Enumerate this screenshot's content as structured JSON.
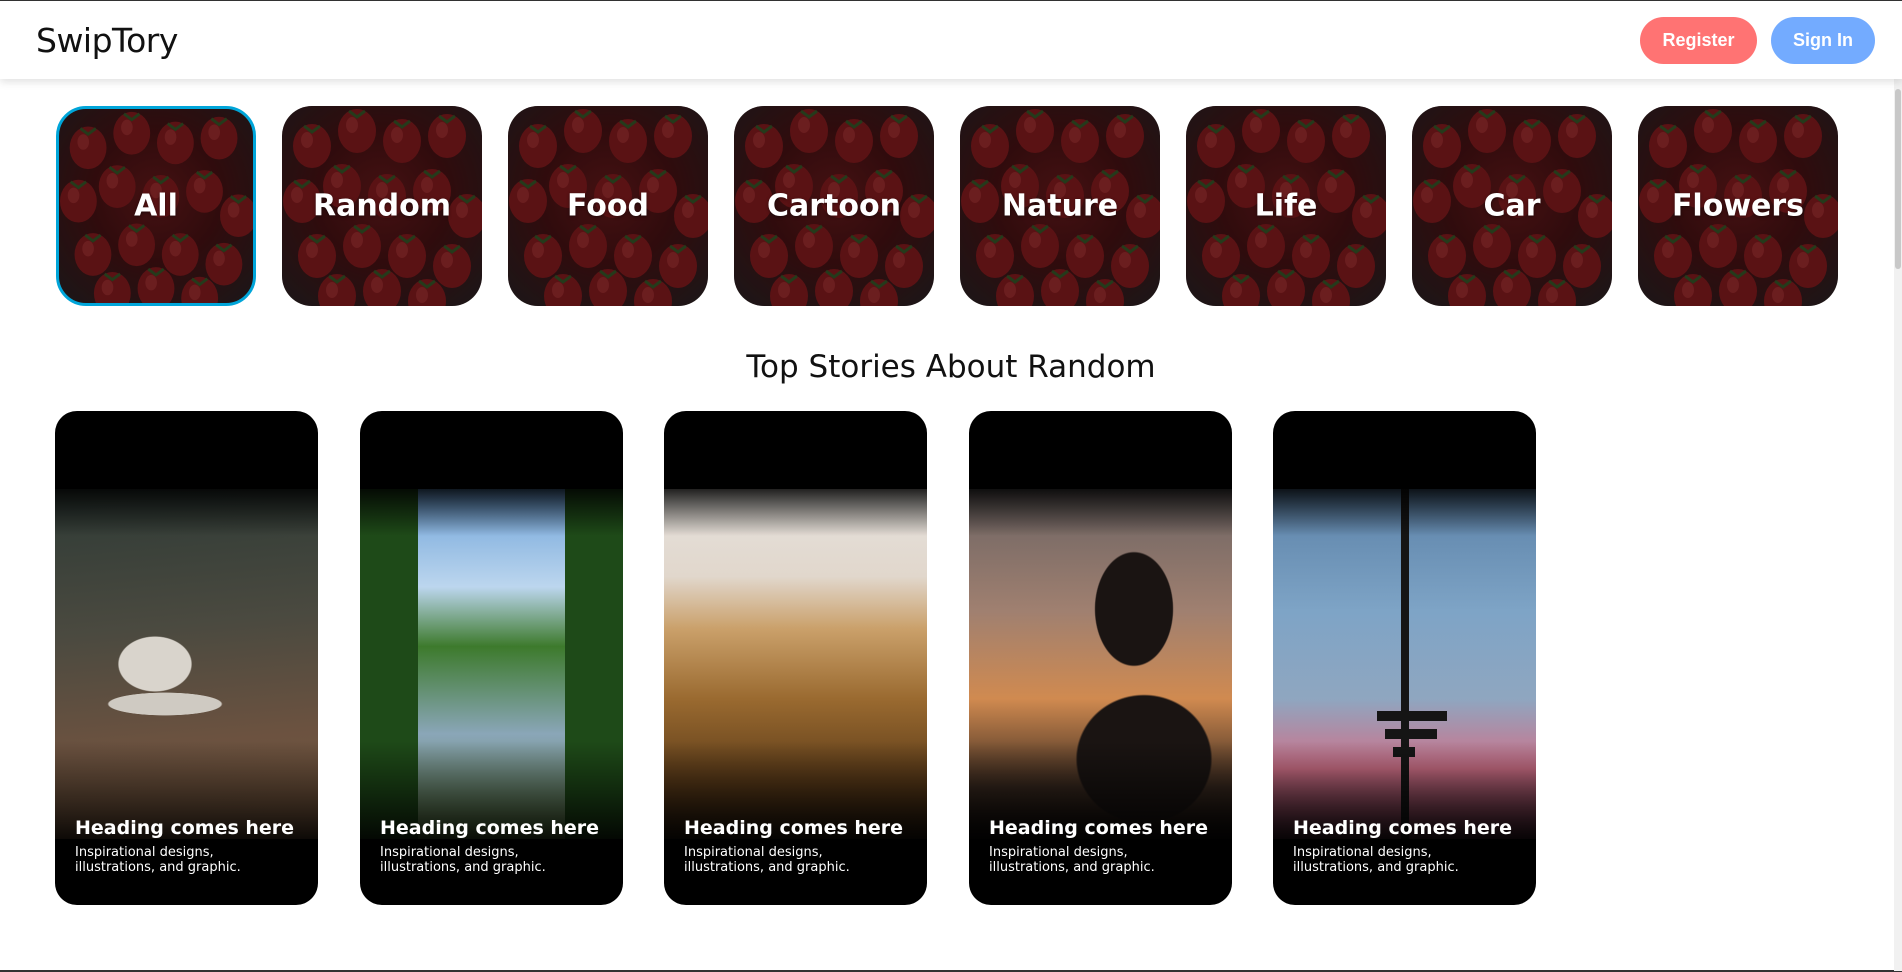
{
  "header": {
    "logo": "SwipTory",
    "register_label": "Register",
    "signin_label": "Sign In",
    "register_color": "#FF7373",
    "signin_color": "#73ABFF"
  },
  "categories": [
    {
      "label": "All",
      "active": true
    },
    {
      "label": "Random",
      "active": false
    },
    {
      "label": "Food",
      "active": false
    },
    {
      "label": "Cartoon",
      "active": false
    },
    {
      "label": "Nature",
      "active": false
    },
    {
      "label": "Life",
      "active": false
    },
    {
      "label": "Car",
      "active": false
    },
    {
      "label": "Flowers",
      "active": false
    }
  ],
  "section": {
    "title": "Top Stories About Random"
  },
  "stories": [
    {
      "heading": "Heading comes here",
      "description": "Inspirational designs, illustrations, and graphic."
    },
    {
      "heading": "Heading comes here",
      "description": "Inspirational designs, illustrations, and graphic."
    },
    {
      "heading": "Heading comes here",
      "description": "Inspirational designs, illustrations, and graphic."
    },
    {
      "heading": "Heading comes here",
      "description": "Inspirational designs, illustrations, and graphic."
    },
    {
      "heading": "Heading comes here",
      "description": "Inspirational designs, illustrations, and graphic."
    }
  ],
  "colors": {
    "active_border": "#00A5D9"
  }
}
